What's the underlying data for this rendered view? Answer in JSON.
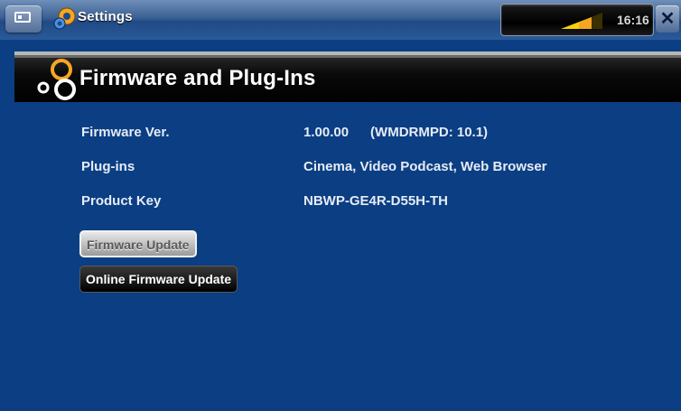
{
  "topbar": {
    "title": "Settings",
    "clock": "16:16",
    "icons": {
      "home": "home-icon",
      "app": "settings-gear-icon",
      "battery": "battery-icon",
      "close": "close-icon"
    }
  },
  "section": {
    "title": "Firmware and Plug-Ins",
    "icon": "plugin-gears-icon"
  },
  "info": {
    "firmware_label": "Firmware Ver.",
    "firmware_value": "1.00.00",
    "firmware_extra": "(WMDRMPD: 10.1)",
    "plugins_label": "Plug-ins",
    "plugins_value": "Cinema, Video Podcast, Web Browser",
    "product_key_label": "Product Key",
    "product_key_value": "NBWP-GE4R-D55H-TH"
  },
  "buttons": {
    "firmware_update": "Firmware Update",
    "online_firmware_update": "Online Firmware Update"
  },
  "colors": {
    "background": "#0b3e83",
    "header_bar": "#000000",
    "accent_orange": "#f5a623"
  }
}
